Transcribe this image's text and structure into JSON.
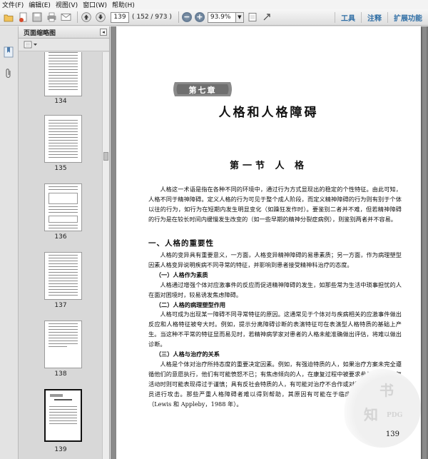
{
  "menubar": {
    "items": [
      "文件(F)",
      "编辑(E)",
      "视图(V)",
      "窗口(W)",
      "帮助(H)"
    ]
  },
  "toolbar": {
    "page_value": "139",
    "page_count": "( 152 / 973 )",
    "zoom_value": "93.9%",
    "right_tabs": [
      "工具",
      "注释",
      "扩展功能"
    ]
  },
  "panel": {
    "title": "页面缩略图",
    "thumbnails": [
      {
        "label": "134"
      },
      {
        "label": "135"
      },
      {
        "label": "136"
      },
      {
        "label": "137"
      },
      {
        "label": "138"
      },
      {
        "label": "139"
      }
    ]
  },
  "document": {
    "chapter_badge": "第七章",
    "chapter_title": "人格和人格障碍",
    "section_title": "第一节  人  格",
    "intro_paragraph": "人格这一术语是指在各种不同的环境中，通过行为方式显现出的稳定的个性特征。由此可知，人格不同于精神障碍。定义人格的行为可见于整个成人阶段，而定义精神障碍的行为则有别于个体以往的行为，如行为在短期内发生明显变化（如躁狂发作时）。要鉴别二者并不难，但若精神障碍的行为是在较长时间内缓慢发生改变的（如一些早期的精神分裂症病例），则鉴别两者并不容易。",
    "h2_importance": "一、人格的重要性",
    "importance_paragraph": "人格的变异具有重要意义，一方面，人格变异精神障碍的易患素质；另一方面，作为病理塑型因素人格变异说明疾病不同寻常的特征，并影响到患者接受精神科治疗的态度。",
    "h3_vulnerability": "（一）人格作为素质",
    "vulnerability_paragraph": "人格通过增强个体对应激事件的反应而促进精神障碍的发生，如那些常为生活中琐事担忧的人在面对困境时，较易诱发焦虑障碍。",
    "h3_pathoplastic": "（二）人格的病理塑型作用",
    "pathoplastic_paragraph": "人格可成为出现某一障碍不同寻常特征的原因。这通常见于个体对与疾病相关的应激事件做出反应和人格特征被夸大时。例如，提示分离障碍诊断的表演特征可在表演型人格特质的基础上产生。当这种不平常的特征显而易见时，若精神病学家对患者的人格未能准确做出评估，将难以做出诊断。",
    "h3_treatment": "（三）人格与治疗的关系",
    "treatment_paragraph": "人格是个体对治疗所持态度的重要决定因素。例如，有强迫特质的人，如果治疗方案未完全遵循他们的意愿执行，他们有可能愤怒不已；有焦虑倾向的人，在康复过程中被要求参与更多的康复活动时则可能表现得过于谨慎；具有反社会特质的人，有可能对治疗不合作或对照顾他们的工作人员进行攻击。那些严重人格障碍者难以得到帮助，其原因有可能在于临床医生不愿接受他们（Lewis 和 Appleby，1988 年）。",
    "page_number": "139"
  },
  "watermark": {
    "chars": [
      "书",
      "知",
      "PDG"
    ]
  },
  "colors": {
    "accent_blue": "#2f6ea5",
    "viewer_bg": "#8b8b8b",
    "panel_bg": "#d8d8d8"
  }
}
